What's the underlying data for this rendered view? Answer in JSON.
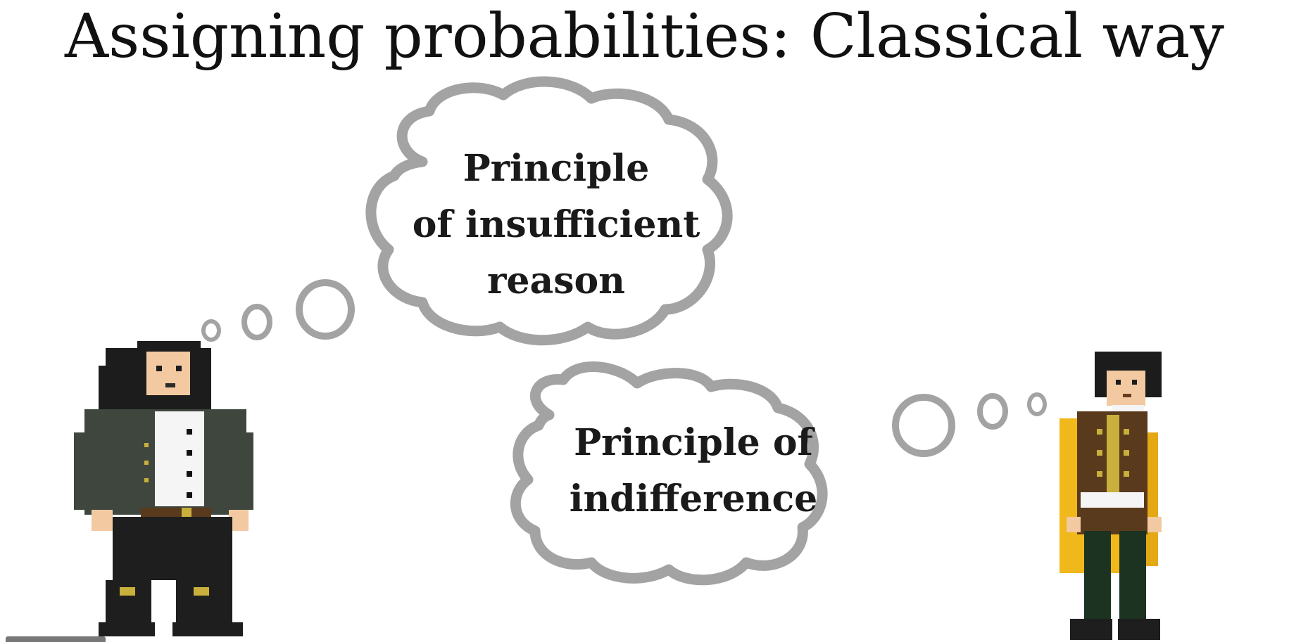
{
  "slide": {
    "title": "Assigning probabilities: Classical way"
  },
  "bubbles": [
    {
      "text": "Principle\nof insufficient\nreason"
    },
    {
      "text": "Principle of\nindifference"
    }
  ],
  "colors": {
    "cloud_outline": "#a3a3a3",
    "coat_left": "#3e463e",
    "coat_right": "#5a3a1c",
    "cape": "#f0b81a",
    "boots": "#1e1e1e",
    "buckle": "#c9b03c",
    "hair": "#1c1c1c",
    "skin": "#f2c9a0"
  },
  "icons": [
    "thought-cloud",
    "thought-trail-dots",
    "pixel-character-bernoulli",
    "pixel-character-laplace"
  ]
}
